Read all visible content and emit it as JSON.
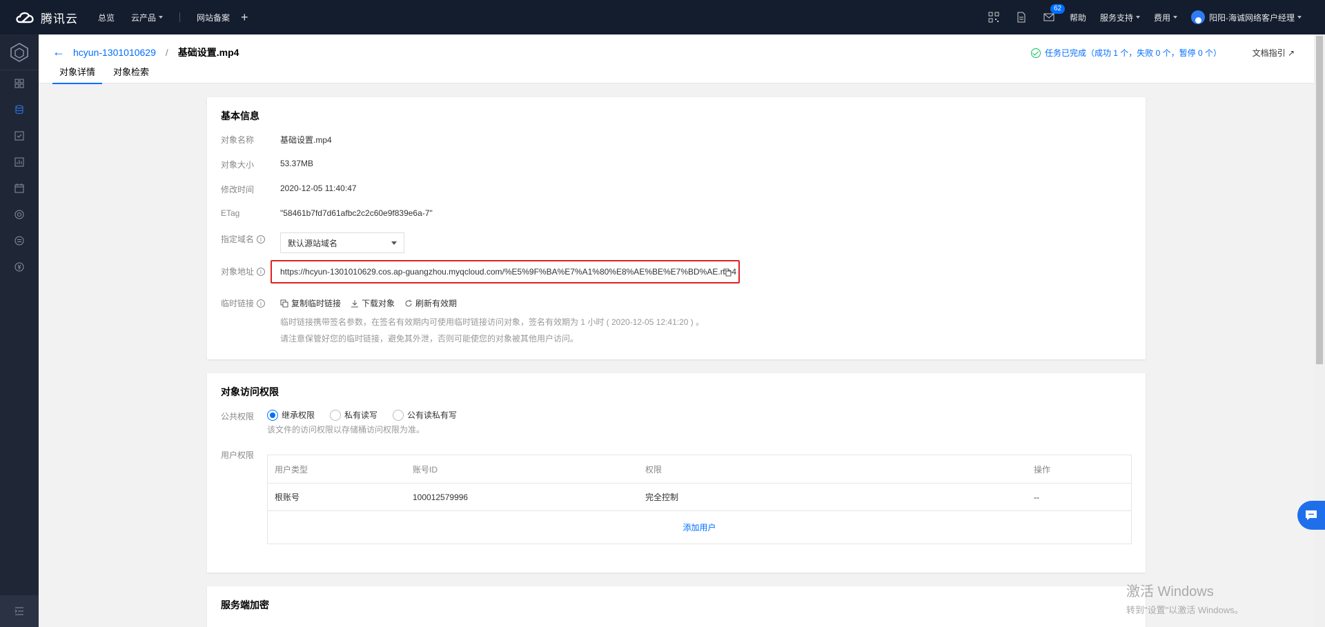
{
  "topbar": {
    "brand": "腾讯云",
    "nav": [
      {
        "label": "总览",
        "dropdown": false
      },
      {
        "label": "云产品",
        "dropdown": true
      },
      {
        "label": "网站备案",
        "dropdown": false
      }
    ],
    "messages_badge": "62",
    "help": "帮助",
    "service": "服务支持",
    "billing": "费用",
    "user": "阳阳-海诚网络客户经理"
  },
  "header": {
    "bucket": "hcyun-1301010629",
    "separator": "/",
    "object": "基础设置.mp4",
    "tabs": [
      "对象详情",
      "对象检索"
    ],
    "task_status": "任务已完成（成功 1 个，失败 0 个，暂停 0 个）",
    "doc_guide": "文档指引"
  },
  "basic_info": {
    "title": "基本信息",
    "name_label": "对象名称",
    "name": "基础设置.mp4",
    "size_label": "对象大小",
    "size": "53.37MB",
    "mtime_label": "修改时间",
    "mtime": "2020-12-05 11:40:47",
    "etag_label": "ETag",
    "etag": "\"58461b7fd7d61afbc2c2c60e9f839e6a-7\"",
    "domain_label": "指定域名",
    "domain_value": "默认源站域名",
    "url_label": "对象地址",
    "url": "https://hcyun-1301010629.cos.ap-guangzhou.myqcloud.com/%E5%9F%BA%E7%A1%80%E8%AE%BE%E7%BD%AE.mp4",
    "temp_label": "临时链接",
    "actions": [
      "复制临时链接",
      "下载对象",
      "刷新有效期"
    ],
    "hint1": "临时链接携带签名参数，在签名有效期内可使用临时链接访问对象，签名有效期为 1 小时 ( 2020-12-05 12:41:20 ) 。",
    "hint2": "请注意保管好您的临时链接，避免其外泄，否则可能使您的对象被其他用户访问。"
  },
  "access": {
    "title": "对象访问权限",
    "public_label": "公共权限",
    "options": [
      "继承权限",
      "私有读写",
      "公有读私有写"
    ],
    "selected": 0,
    "public_hint": "该文件的访问权限以存储桶访问权限为准。",
    "user_label": "用户权限",
    "columns": [
      "用户类型",
      "账号ID",
      "权限",
      "操作"
    ],
    "rows": [
      [
        "根账号",
        "100012579996",
        "完全控制",
        "--"
      ]
    ],
    "add_user": "添加用户"
  },
  "encryption": {
    "title": "服务端加密"
  },
  "watermark": {
    "line1": "激活 Windows",
    "line2": "转到\"设置\"以激活 Windows。"
  }
}
